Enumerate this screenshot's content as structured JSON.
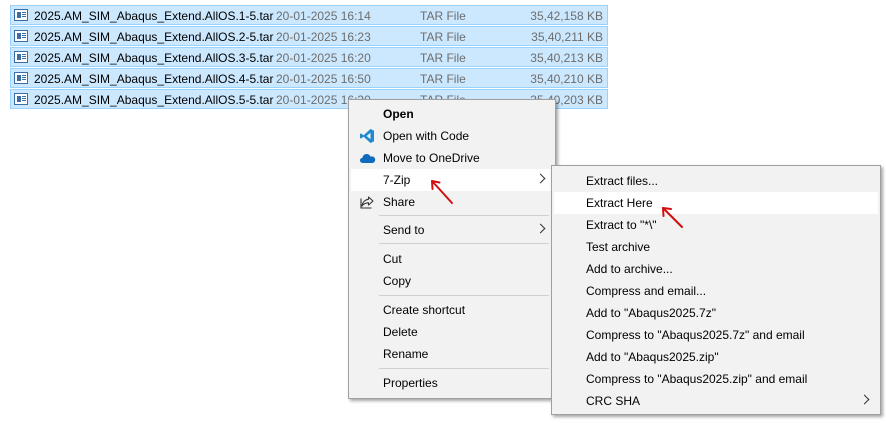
{
  "files": [
    {
      "name": "2025.AM_SIM_Abaqus_Extend.AllOS.1-5.tar",
      "date": "20-01-2025 16:14",
      "type": "TAR File",
      "size": "35,42,158 KB"
    },
    {
      "name": "2025.AM_SIM_Abaqus_Extend.AllOS.2-5.tar",
      "date": "20-01-2025 16:23",
      "type": "TAR File",
      "size": "35,40,211 KB"
    },
    {
      "name": "2025.AM_SIM_Abaqus_Extend.AllOS.3-5.tar",
      "date": "20-01-2025 16:20",
      "type": "TAR File",
      "size": "35,40,213 KB"
    },
    {
      "name": "2025.AM_SIM_Abaqus_Extend.AllOS.4-5.tar",
      "date": "20-01-2025 16:50",
      "type": "TAR File",
      "size": "35,40,210 KB"
    },
    {
      "name": "2025.AM_SIM_Abaqus_Extend.AllOS.5-5.tar",
      "date": "20-01-2025 16:30",
      "type": "TAR File",
      "size": "35,40,203 KB"
    }
  ],
  "context_menu": {
    "open": "Open",
    "open_with_code": "Open with Code",
    "move_to_onedrive": "Move to OneDrive",
    "seven_zip": "7-Zip",
    "share": "Share",
    "send_to": "Send to",
    "cut": "Cut",
    "copy": "Copy",
    "create_shortcut": "Create shortcut",
    "delete": "Delete",
    "rename": "Rename",
    "properties": "Properties"
  },
  "submenu": {
    "extract_files": "Extract files...",
    "extract_here": "Extract Here",
    "extract_to": "Extract to \"*\\\"",
    "test_archive": "Test archive",
    "add_to_archive": "Add to archive...",
    "compress_and_email": "Compress and email...",
    "add_to_7z": "Add to \"Abaqus2025.7z\"",
    "compress_7z_email": "Compress to \"Abaqus2025.7z\" and email",
    "add_to_zip": "Add to \"Abaqus2025.zip\"",
    "compress_zip_email": "Compress to \"Abaqus2025.zip\" and email",
    "crc_sha": "CRC SHA"
  },
  "colors": {
    "selection": "#cce8ff",
    "selection_border": "#99d1ff",
    "menu_bg": "#f2f2f2",
    "annotation_arrow": "#d01010",
    "vscode_blue": "#1f8ad2",
    "onedrive_blue": "#0f6cbd"
  },
  "icons": [
    "tar-file-icon",
    "vscode-icon",
    "onedrive-icon",
    "share-icon",
    "chevron-right-icon",
    "annotation-arrow"
  ]
}
